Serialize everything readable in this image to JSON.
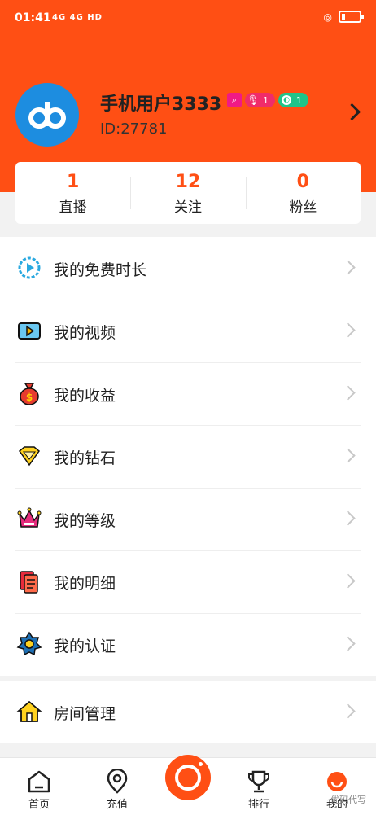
{
  "status_bar": {
    "time": "01:41",
    "signal": "4G 4G HD",
    "right": "◎"
  },
  "profile": {
    "username": "手机用户3333",
    "user_id": "ID:27781",
    "mic_level": "1",
    "coin_level": "1"
  },
  "stats": [
    {
      "value": "1",
      "label": "直播"
    },
    {
      "value": "12",
      "label": "关注"
    },
    {
      "value": "0",
      "label": "粉丝"
    }
  ],
  "menu": [
    {
      "label": "我的免费时长",
      "icon": "clock-play-icon"
    },
    {
      "label": "我的视频",
      "icon": "video-icon"
    },
    {
      "label": "我的收益",
      "icon": "money-bag-icon"
    },
    {
      "label": "我的钻石",
      "icon": "diamond-icon"
    },
    {
      "label": "我的等级",
      "icon": "crown-icon"
    },
    {
      "label": "我的明细",
      "icon": "detail-icon"
    },
    {
      "label": "我的认证",
      "icon": "badge-icon"
    }
  ],
  "menu2": [
    {
      "label": "房间管理",
      "icon": "house-icon"
    }
  ],
  "tabs": [
    {
      "label": "首页"
    },
    {
      "label": "充值"
    },
    {
      "label": "排行"
    },
    {
      "label": "我的"
    }
  ],
  "watermark": "优码代写",
  "colors": {
    "primary": "#ff4f14",
    "avatar_bg": "#1d8de0"
  }
}
